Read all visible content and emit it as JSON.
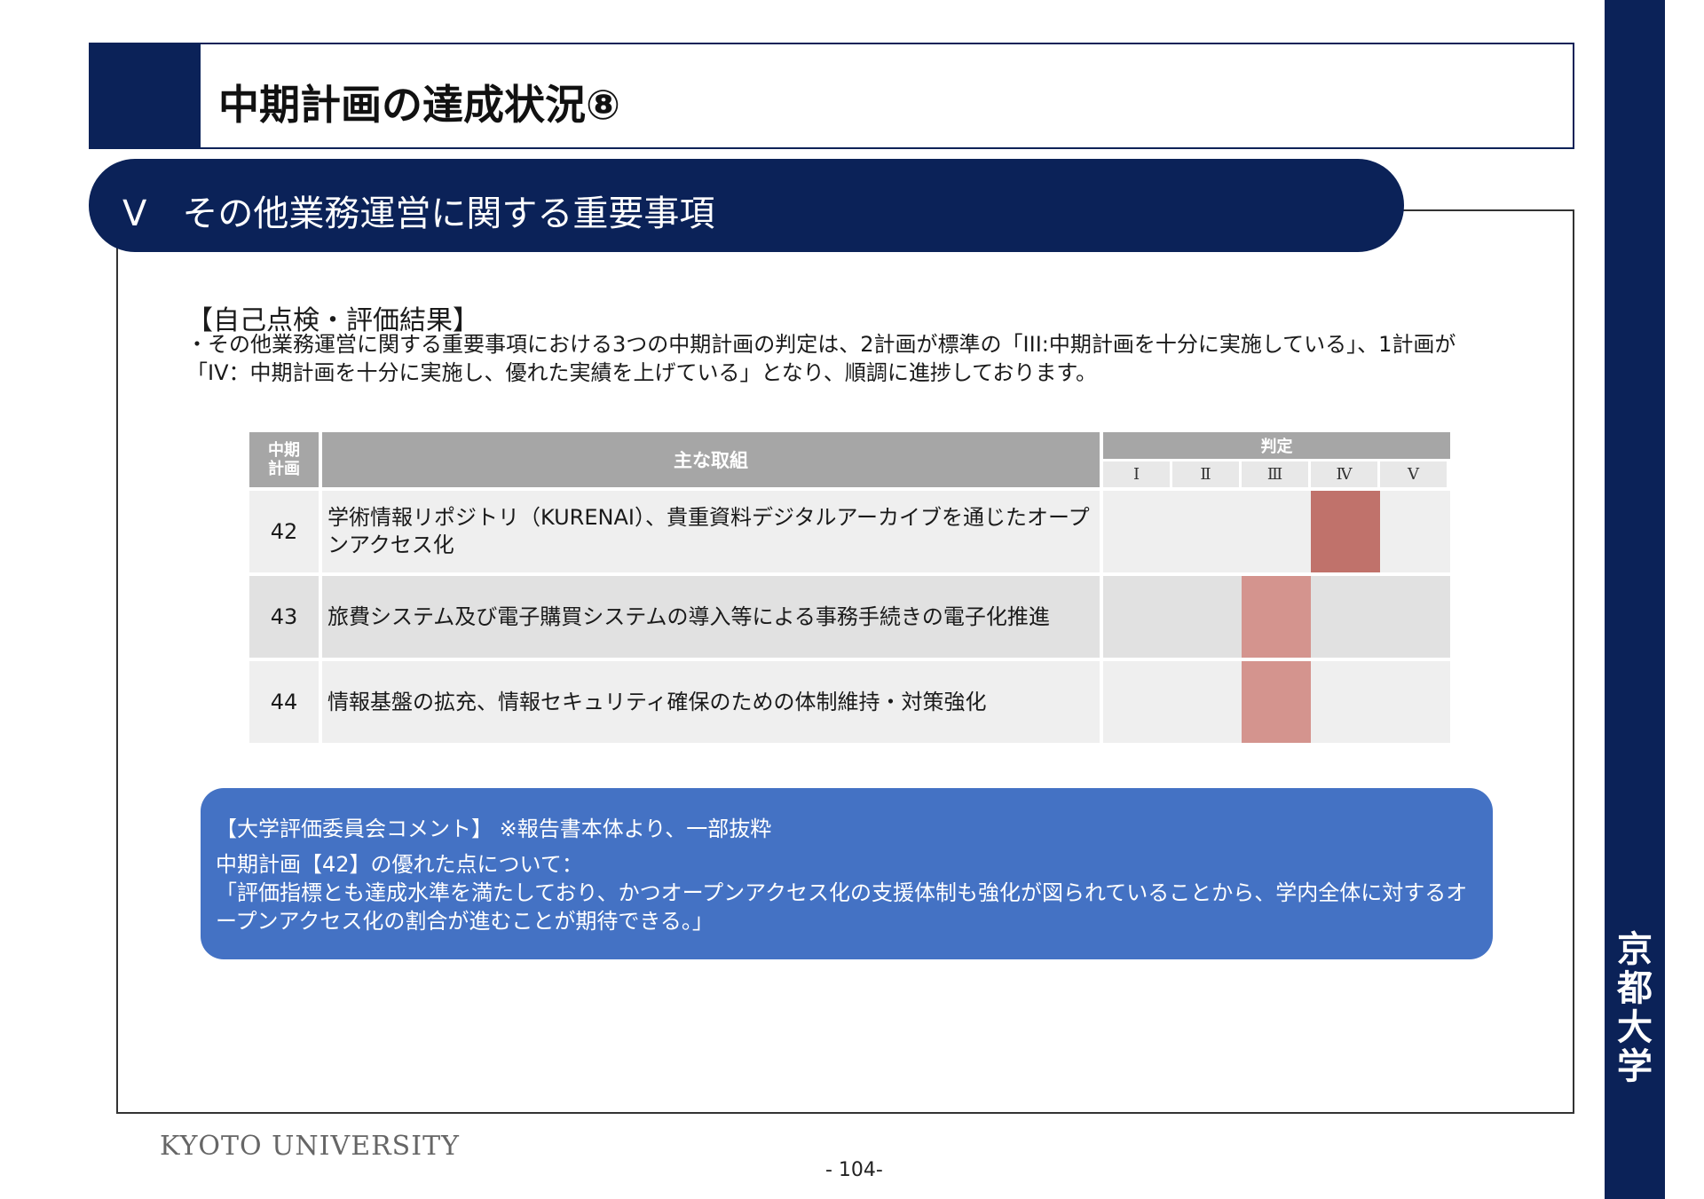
{
  "header": {
    "title": "中期計画の達成状況⑧"
  },
  "section": {
    "title": "Ⅴ　その他業務運営に関する重要事項"
  },
  "evaluation": {
    "heading": "【自己点検・評価結果】",
    "body": "・その他業務運営に関する重要事項における3つの中期計画の判定は、2計画が標準の「III:中期計画を十分に実施している」、1計画が「IV：中期計画を十分に実施し、優れた実績を上げている」となり、順調に進捗しております。"
  },
  "table": {
    "header_plan": "中期\n計画",
    "header_main": "主な取組",
    "header_judge": "判定",
    "levels": [
      "Ⅰ",
      "Ⅱ",
      "Ⅲ",
      "Ⅳ",
      "Ⅴ"
    ],
    "rows": [
      {
        "plan": "42",
        "text": "学術情報リポジトリ（KURENAI）、貴重資料デジタルアーカイブを通じたオープンアクセス化",
        "judgment": "Ⅳ"
      },
      {
        "plan": "43",
        "text": "旅費システム及び電子購買システムの導入等による事務手続きの電子化推進",
        "judgment": "Ⅲ"
      },
      {
        "plan": "44",
        "text": "情報基盤の拡充、情報セキュリティ確保のための体制維持・対策強化",
        "judgment": "Ⅲ"
      }
    ],
    "colors": {
      "header_bg": "#a6a6a6",
      "row_light": "#efefef",
      "row_dark": "#e1e1e1",
      "mark_iv": "#c0726b",
      "mark_iii": "#d4948e"
    }
  },
  "comment": {
    "heading": "【大学評価委員会コメント】 ※報告書本体より、一部抜粋",
    "body": "中期計画【42】の優れた点について：\n「評価指標とも達成水準を満たしており、かつオープンアクセス化の支援体制も強化が図られていることから、学内全体に対するオープンアクセス化の割合が進むことが期待できる。」"
  },
  "brand": {
    "vertical_name": "京都大学",
    "footer_name": "KYOTO UNIVERSITY"
  },
  "footer": {
    "page": "- 104-"
  }
}
